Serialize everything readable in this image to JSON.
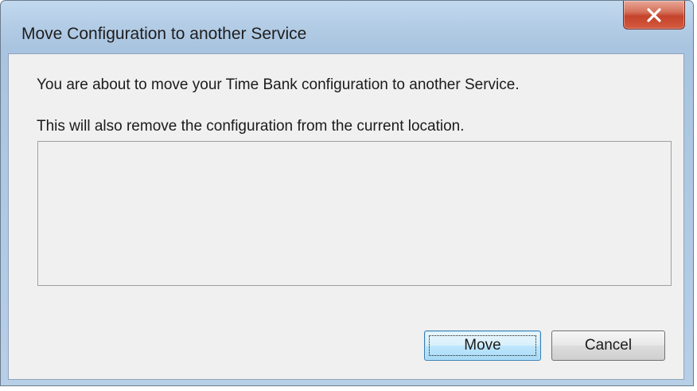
{
  "dialog": {
    "title": "Move Configuration to another Service",
    "close_label": "X",
    "message_1": "You are about to move your Time Bank configuration to another Service.",
    "message_2": "This will also remove the configuration from the current location.",
    "buttons": {
      "move": "Move",
      "cancel": "Cancel"
    }
  },
  "colors": {
    "close_button": "#c4432b",
    "default_button_border": "#3c7fb1",
    "frame": "#b4cde6"
  },
  "icons": {
    "close": "close-icon"
  }
}
